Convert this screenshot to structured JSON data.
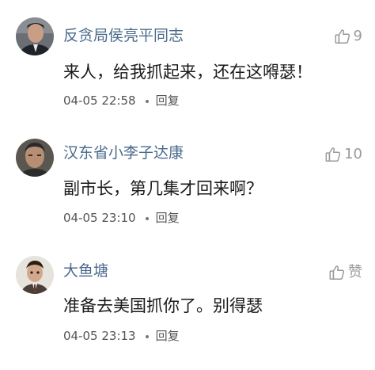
{
  "comments": [
    {
      "username": "反贪局侯亮平同志",
      "like_icon": "thumbs-up-icon",
      "like_count": "9",
      "text": "来人，给我抓起来，还在这嘚瑟！",
      "timestamp": "04-05 22:58",
      "reply_label": "回复"
    },
    {
      "username": "汉东省小李子达康",
      "like_icon": "thumbs-up-icon",
      "like_count": "10",
      "text": "副市长，第几集才回来啊？",
      "timestamp": "04-05 23:10",
      "reply_label": "回复"
    },
    {
      "username": "大鱼塘",
      "like_icon": "thumbs-up-icon",
      "like_count": "赞",
      "text": "准备去美国抓你了。别得瑟",
      "timestamp": "04-05 23:13",
      "reply_label": "回复"
    }
  ],
  "colors": {
    "username": "#4a6a8d",
    "text": "#1a1a1a",
    "meta": "#555555",
    "like": "#9a9a9a"
  }
}
